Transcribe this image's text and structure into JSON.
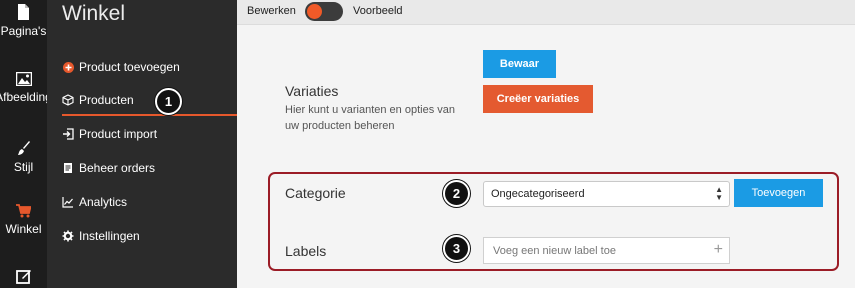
{
  "rail": {
    "items": [
      {
        "label": "Pagina's",
        "icon": "page-icon"
      },
      {
        "label": "Afbeelding",
        "icon": "image-icon"
      },
      {
        "label": "Stijl",
        "icon": "brush-icon"
      },
      {
        "label": "Winkel",
        "icon": "cart-icon"
      },
      {
        "label": "",
        "icon": "edit-icon"
      }
    ],
    "active_color": "#e6582c"
  },
  "sidebar": {
    "title": "Winkel",
    "items": [
      {
        "label": "Product toevoegen",
        "icon": "plus-circle-icon"
      },
      {
        "label": "Producten",
        "icon": "box-icon"
      },
      {
        "label": "Product import",
        "icon": "import-icon"
      },
      {
        "label": "Beheer orders",
        "icon": "receipt-icon"
      },
      {
        "label": "Analytics",
        "icon": "chart-icon"
      },
      {
        "label": "Instellingen",
        "icon": "gear-icon"
      }
    ],
    "active_item": "Producten"
  },
  "topbar": {
    "edit_label": "Bewerken",
    "preview_label": "Voorbeeld"
  },
  "variations": {
    "save_button": "Bewaar",
    "create_button": "Creëer variaties",
    "heading": "Variaties",
    "description": "Hier kunt u varianten en opties van uw producten beheren"
  },
  "category": {
    "label": "Categorie",
    "selected": "Ongecategoriseerd",
    "add_button": "Toevoegen"
  },
  "labels": {
    "label": "Labels",
    "placeholder": "Voeg een nieuw label toe"
  },
  "callouts": [
    "1",
    "2",
    "3"
  ],
  "colors": {
    "accent": "#e6582c",
    "primary_button": "#1b9be4",
    "highlight_border": "#9b1c26"
  }
}
